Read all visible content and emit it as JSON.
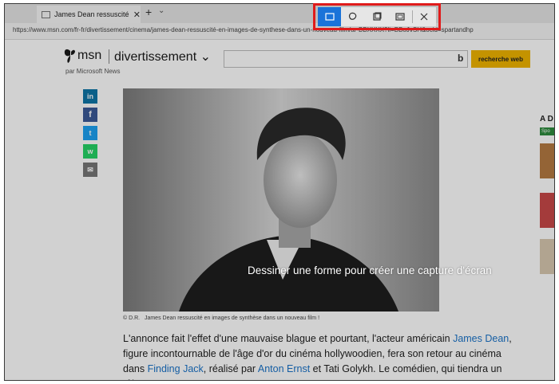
{
  "browser": {
    "tab_title": "James Dean ressuscité en images de synthèse dans un nouveau film !",
    "new_tab_symbol": "+",
    "tab_list_symbol": "⌄",
    "close_tab_symbol": "✕",
    "url": "https://www.msn.com/fr-fr/divertissement/cinema/james-dean-ressuscité-en-images-de-synthese-dans-un-nouveau-film/ar-BBXXXX?li=BBoJvSH&ocid=spartandhp"
  },
  "site": {
    "logo_text": "msn",
    "by_line": "par Microsoft News",
    "section_label": "divertissement",
    "section_chevron": "⌄",
    "search_placeholder": "",
    "bing_glyph": "b",
    "search_button": "recherche web"
  },
  "share": {
    "linkedin": "in",
    "facebook": "f",
    "twitter": "t",
    "whatsapp": "w",
    "email": "✉"
  },
  "article": {
    "caption_credit": "© D.R.",
    "caption_text": "James Dean ressuscité en images de synthèse dans un nouveau film !",
    "p1_a": "L'annonce fait l'effet d'une mauvaise blague et pourtant, l'acteur américain ",
    "p1_link1": "James Dean",
    "p1_b": ", figure incontournable de l'âge d'or du cinéma hollywoodien, fera son retour au cinéma dans ",
    "p1_link2": "Finding Jack",
    "p1_c": ", réalisé par ",
    "p1_link3": "Anton Ernst",
    "p1_d": " et Tati Golykh. Le comédien, qui tiendra un rôle"
  },
  "right_rail": {
    "heading": "A D",
    "tag": "Spo"
  },
  "snip": {
    "overlay_hint": "Dessiner une forme pour créer une capture d'écran",
    "modes": [
      "rectangle-snip",
      "freeform-snip",
      "window-snip",
      "fullscreen-snip"
    ],
    "active_mode": "rectangle-snip",
    "accent": "#1a73d9",
    "highlight_color": "#e01b1b"
  }
}
